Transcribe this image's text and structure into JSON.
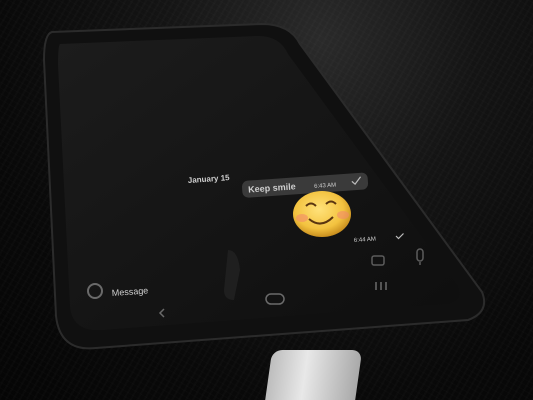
{
  "chat": {
    "date_label": "January 15",
    "message_text": "Keep smile",
    "message_time": "6:43 AM",
    "emoji_time": "6:44 AM",
    "input_placeholder": "Message"
  },
  "icons": [
    "check-icon",
    "smiley-emoji-icon",
    "camera-icon",
    "mic-icon",
    "emoji-picker-icon",
    "back-nav-icon",
    "home-nav-icon",
    "recents-nav-icon"
  ],
  "colors": {
    "bubble": "#3a3a3a",
    "emoji_face": "#f6c945",
    "background": "#0c0c0c"
  }
}
